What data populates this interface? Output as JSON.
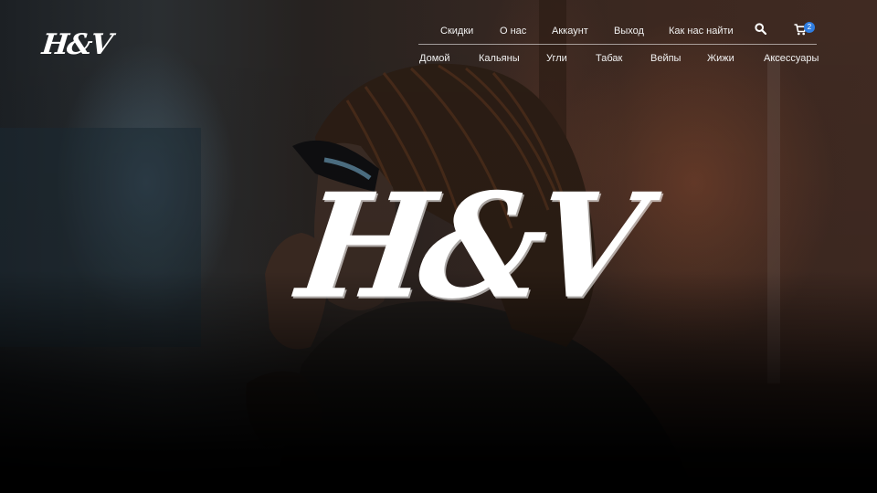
{
  "brand": {
    "logo_text": "H&V"
  },
  "nav": {
    "top_links": [
      "Скидки",
      "О нас",
      "Аккаунт",
      "Выход",
      "Как нас найти"
    ],
    "main_links": [
      "Домой",
      "Кальяны",
      "Угли",
      "Табак",
      "Вейпы",
      "Жижи",
      "Аксессуары"
    ],
    "search_icon": "search-icon",
    "cart_icon": "cart-icon",
    "cart_count": "2"
  },
  "hero": {
    "logo_text": "H&V"
  },
  "colors": {
    "badge": "#2f7de1",
    "text": "#ffffff",
    "background": "#0b0a09"
  }
}
